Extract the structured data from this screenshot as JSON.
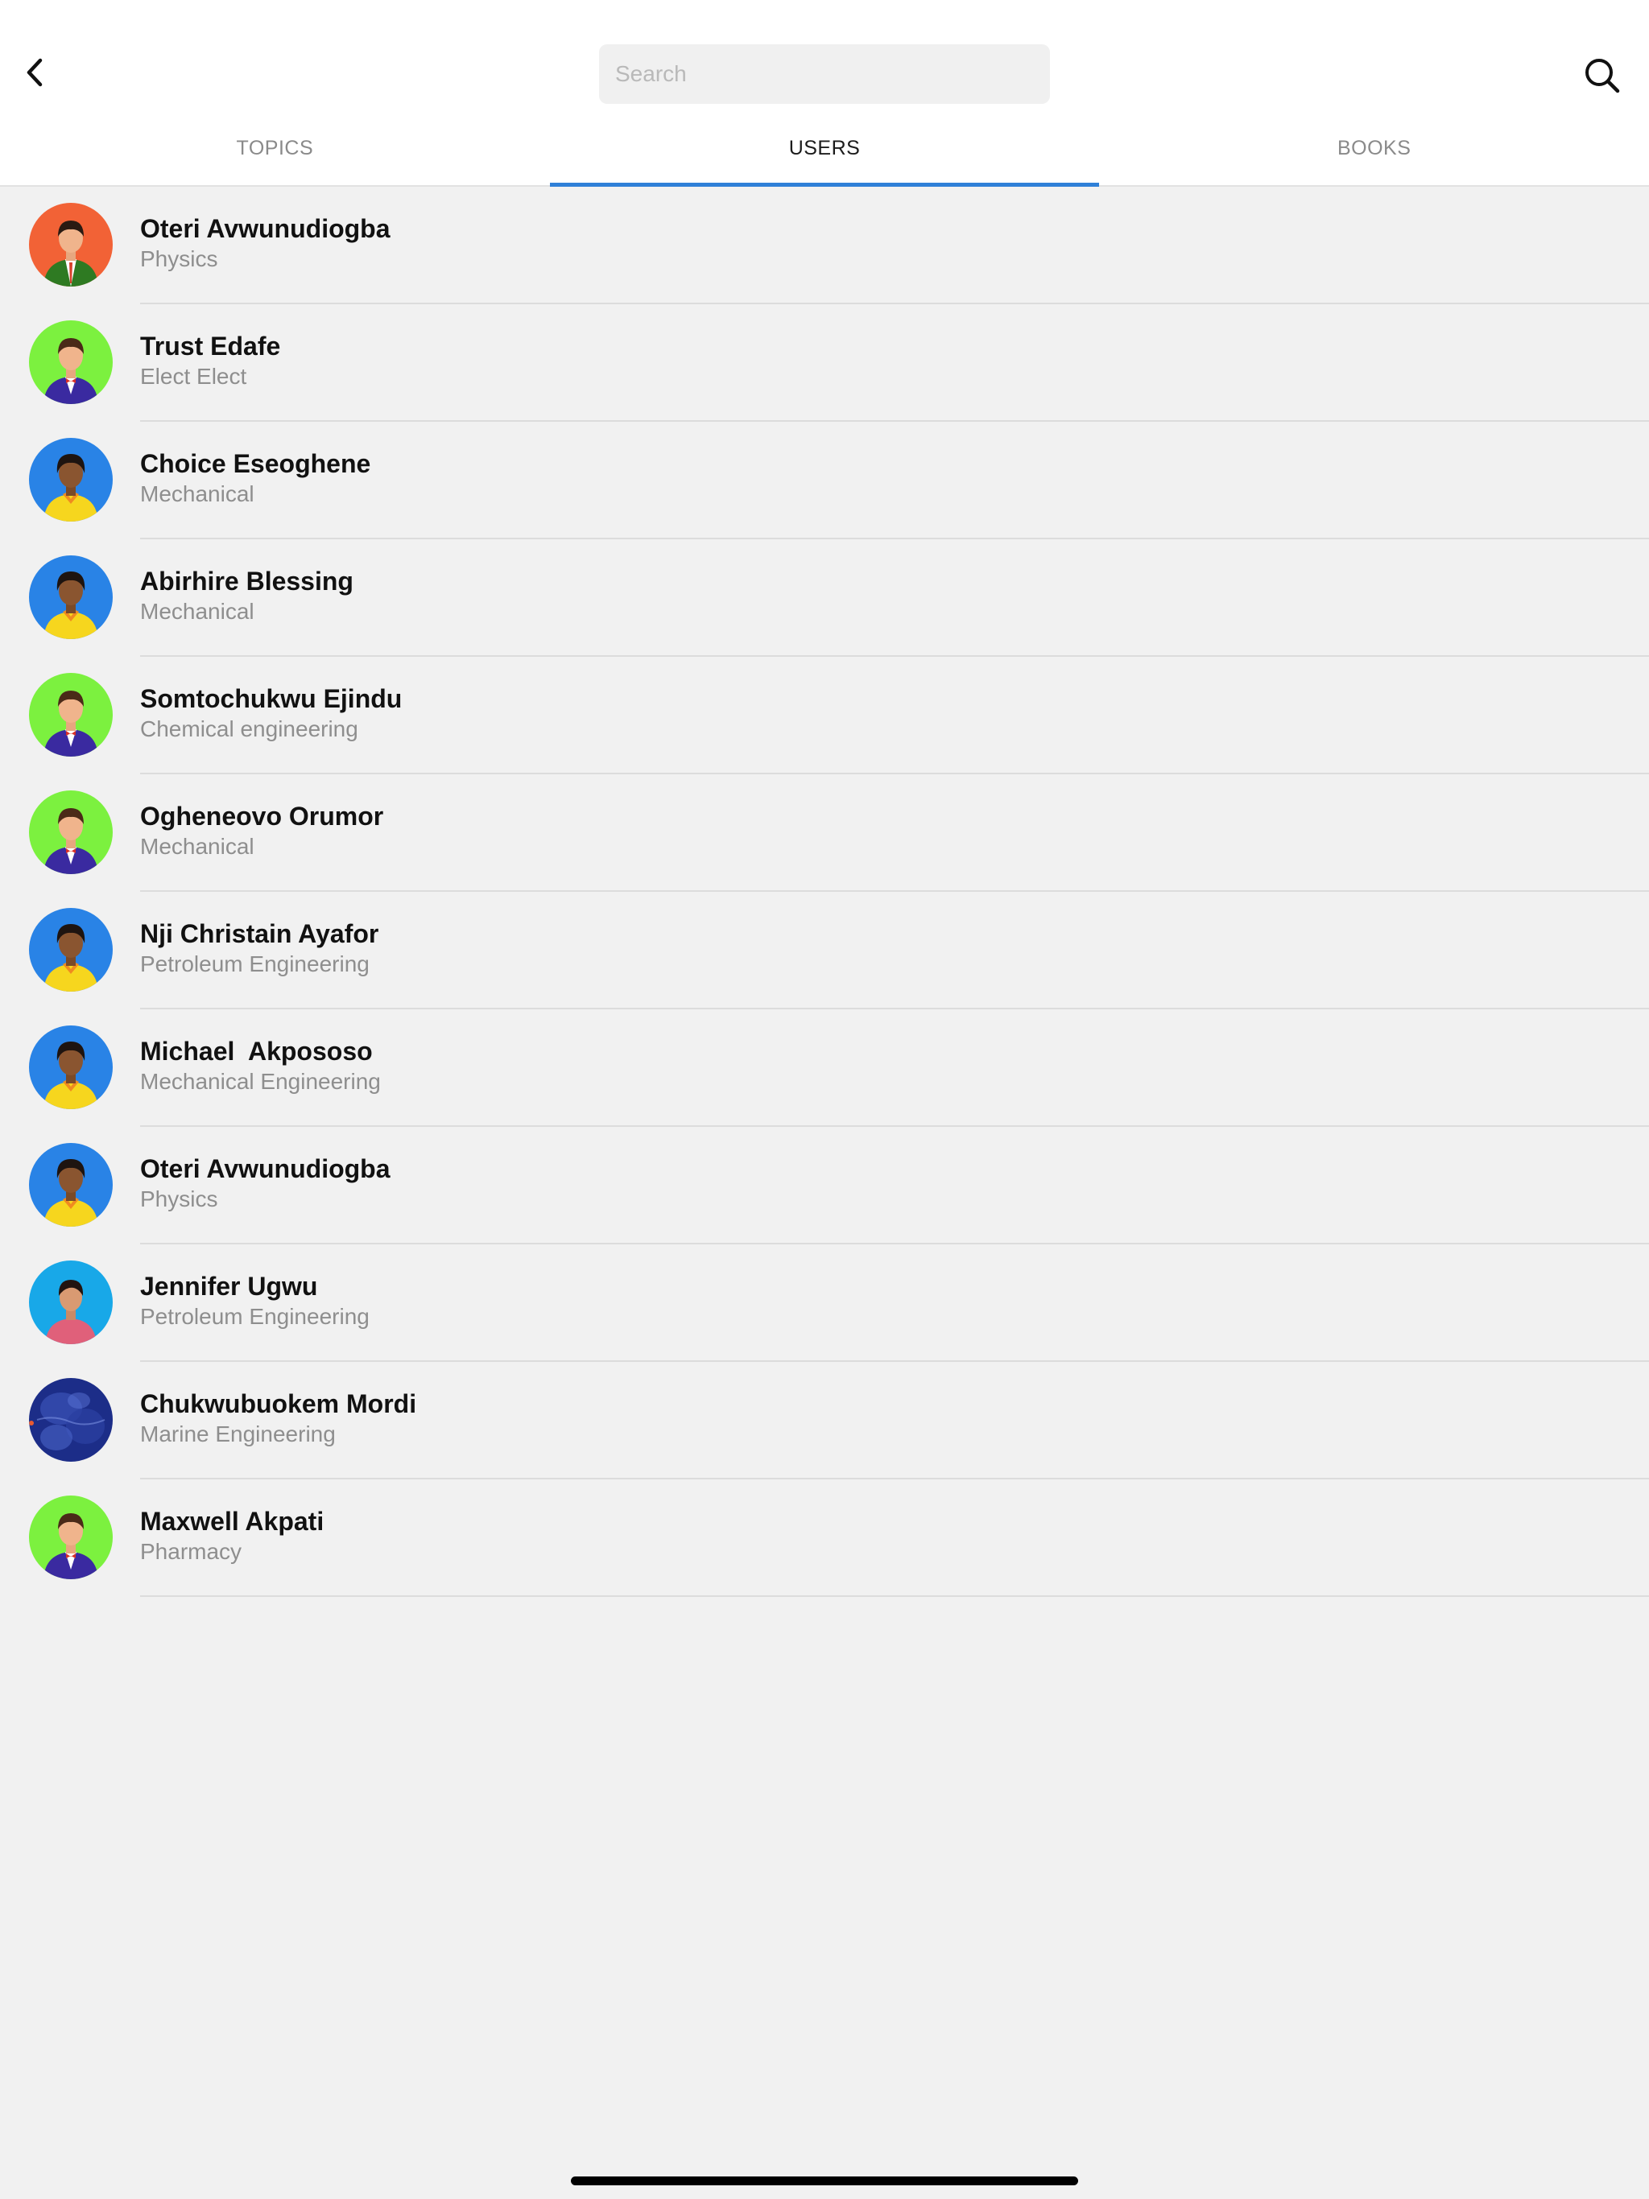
{
  "header": {
    "back_icon": "chevron-left-icon",
    "search_placeholder": "Search",
    "search_icon": "search-icon"
  },
  "tabs": [
    {
      "label": "TOPICS",
      "active": false
    },
    {
      "label": "USERS",
      "active": true
    },
    {
      "label": "BOOKS",
      "active": false
    }
  ],
  "colors": {
    "accent": "#2f80d8",
    "background": "#f1f1f1",
    "avatar_orange": "#f26236",
    "avatar_green": "#7cf13f",
    "avatar_blue": "#2983e6",
    "avatar_cyan": "#18a8e8",
    "avatar_photo": "#1c2d88"
  },
  "users": [
    {
      "name": "Oteri Avwunudiogba",
      "dept": "Physics",
      "avatar": "man-green-suit-orange-bg"
    },
    {
      "name": "Trust Edafe",
      "dept": "Elect Elect",
      "avatar": "man-purple-suit-green-bg"
    },
    {
      "name": "Choice Eseoghene",
      "dept": "Mechanical",
      "avatar": "man-yellow-shirt-blue-bg"
    },
    {
      "name": "Abirhire Blessing",
      "dept": "Mechanical",
      "avatar": "man-yellow-shirt-blue-bg"
    },
    {
      "name": "Somtochukwu Ejindu",
      "dept": "Chemical engineering",
      "avatar": "man-purple-suit-green-bg"
    },
    {
      "name": "Ogheneovo Orumor",
      "dept": "Mechanical",
      "avatar": "man-purple-suit-green-bg"
    },
    {
      "name": "Nji Christain Ayafor",
      "dept": "Petroleum Engineering",
      "avatar": "man-yellow-shirt-blue-bg"
    },
    {
      "name": "Michael  Akpososo",
      "dept": "Mechanical Engineering",
      "avatar": "man-yellow-shirt-blue-bg"
    },
    {
      "name": "Oteri Avwunudiogba",
      "dept": "Physics",
      "avatar": "man-yellow-shirt-blue-bg"
    },
    {
      "name": "Jennifer Ugwu",
      "dept": "Petroleum Engineering",
      "avatar": "woman-pink-shirt-cyan-bg"
    },
    {
      "name": "Chukwubuokem Mordi",
      "dept": "Marine Engineering",
      "avatar": "photo-blue-texture"
    },
    {
      "name": "Maxwell Akpati",
      "dept": "Pharmacy",
      "avatar": "man-purple-suit-green-bg"
    }
  ]
}
